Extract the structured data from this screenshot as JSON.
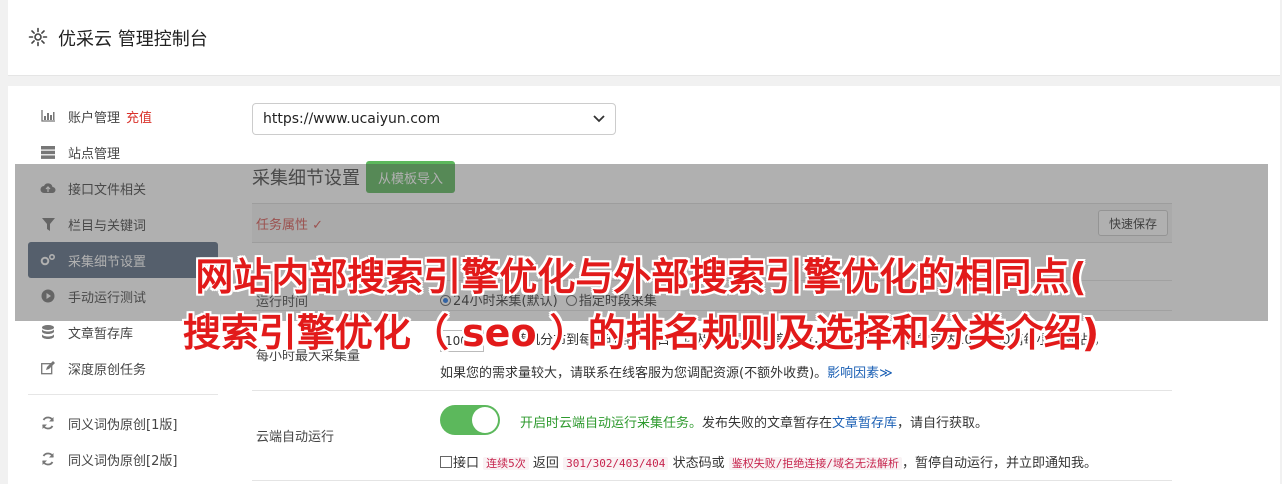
{
  "header": {
    "title": "优采云 管理控制台",
    "icon": "gear-icon"
  },
  "sidebar": {
    "items": [
      {
        "label": "账户管理",
        "extra": "充值",
        "icon": "bar-chart-icon"
      },
      {
        "label": "站点管理",
        "icon": "server-icon"
      },
      {
        "label": "接口文件相关",
        "icon": "cloud-upload-icon"
      },
      {
        "label": "栏目与关键词",
        "icon": "filter-icon"
      },
      {
        "label": "采集细节设置",
        "icon": "gears-icon",
        "active": true
      },
      {
        "label": "手动运行测试",
        "icon": "play-circle-icon"
      },
      {
        "label": "文章暂存库",
        "icon": "database-icon"
      },
      {
        "label": "深度原创任务",
        "icon": "edit-icon"
      },
      {
        "label": "同义词伪原创[1版]",
        "icon": "refresh-icon"
      },
      {
        "label": "同义词伪原创[2版]",
        "icon": "refresh-icon"
      }
    ]
  },
  "main": {
    "site_select": "https://www.ucaiyun.com",
    "section_title": "采集细节设置",
    "template_import": "从模板导入",
    "task_attr": "任务属性 ✓",
    "quick_save": "快速保存",
    "run_time": {
      "label": "运行时间",
      "opt1": "24小时采集(默认)",
      "opt2": "指定时段采集"
    },
    "max_per_hour": {
      "label": "每小时最大采集量",
      "value": "100",
      "text1": "篇，随机分布到每小时各个栏目，以及每次更新文章数量，一般不超过，通常可达100-300篇每小时每站)，",
      "text2": "如果您的需求量较大，请联系在线客服为您调配资源(不额外收费)。",
      "link": "影响因素≫"
    },
    "cloud_run": {
      "label": "云端自动运行",
      "on_text": "开启时云端自动运行采集任务。",
      "text_a": "发布失败的文章暂存在",
      "link": "文章暂存库",
      "text_b": "，请自行获取。",
      "chk_text1": "接口",
      "code1": "连续5次",
      "chk_text2": "返回",
      "code2": "301/302/403/404",
      "chk_text3": "状态码或",
      "code3": "鉴权失败/拒绝连接/域名无法解析",
      "chk_text4": "，暂停自动运行，并立即通知我。"
    }
  },
  "overlay": {
    "line1": "网站内部搜索引擎优化与外部搜索引擎优化的相同点(",
    "line2": "搜索引擎优化（ seo ）的排名规则及选择和分类介绍)"
  },
  "colors": {
    "accent_green": "#5cb85c",
    "active_nav": "#5a6c83",
    "overlay_text": "#e21a1a"
  }
}
